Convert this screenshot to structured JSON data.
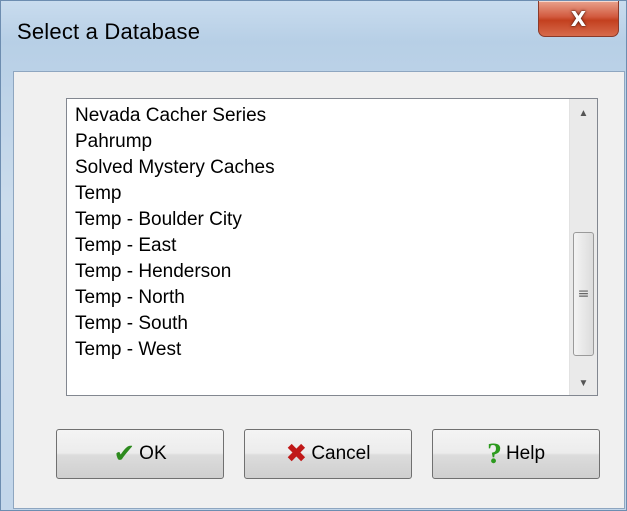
{
  "window": {
    "title": "Select a Database",
    "close_label": "X"
  },
  "database_list": {
    "items": [
      "Nevada Cacher Series",
      "Pahrump",
      "Solved Mystery Caches",
      "Temp",
      "Temp - Boulder City",
      "Temp - East",
      "Temp - Henderson",
      "Temp - North",
      "Temp - South",
      "Temp - West"
    ],
    "scroll": {
      "up_glyph": "▲",
      "down_glyph": "▼",
      "grip_glyph": "≡"
    }
  },
  "buttons": {
    "ok": {
      "label": "OK",
      "icon": "check-icon",
      "glyph": "✔"
    },
    "cancel": {
      "label": "Cancel",
      "icon": "x-icon",
      "glyph": "✖"
    },
    "help": {
      "label": "Help",
      "icon": "question-icon",
      "glyph": "?"
    }
  },
  "colors": {
    "close_button": "#c3401f",
    "ok_icon": "#2d8a1e",
    "cancel_icon": "#c01818",
    "help_icon": "#2c9a1e"
  }
}
